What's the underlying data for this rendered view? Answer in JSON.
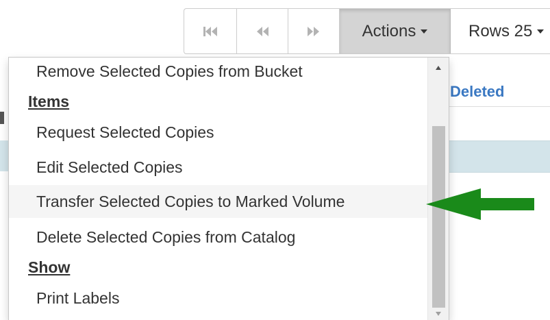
{
  "toolbar": {
    "actions_label": "Actions",
    "rows_label": "Rows 25",
    "first_page_icon": "skip-to-first-icon",
    "prev_page_icon": "rewind-icon",
    "next_page_icon": "fast-forward-icon"
  },
  "background": {
    "column_header": "Deleted"
  },
  "menu": {
    "remove_item": "Remove Selected Copies from Bucket",
    "items_header": "Items",
    "request_item": "Request Selected Copies",
    "edit_item": "Edit Selected Copies",
    "transfer_item": "Transfer Selected Copies to Marked Volume",
    "delete_item": "Delete Selected Copies from Catalog",
    "show_header": "Show",
    "print_item": "Print Labels"
  },
  "annotation": {
    "arrow_color": "#1a8a1a",
    "arrow_icon": "left-pointing-arrow-icon"
  },
  "colors": {
    "link_blue": "#3a78c2",
    "selected_row": "#d3e4ea",
    "active_button": "#d4d4d4"
  }
}
